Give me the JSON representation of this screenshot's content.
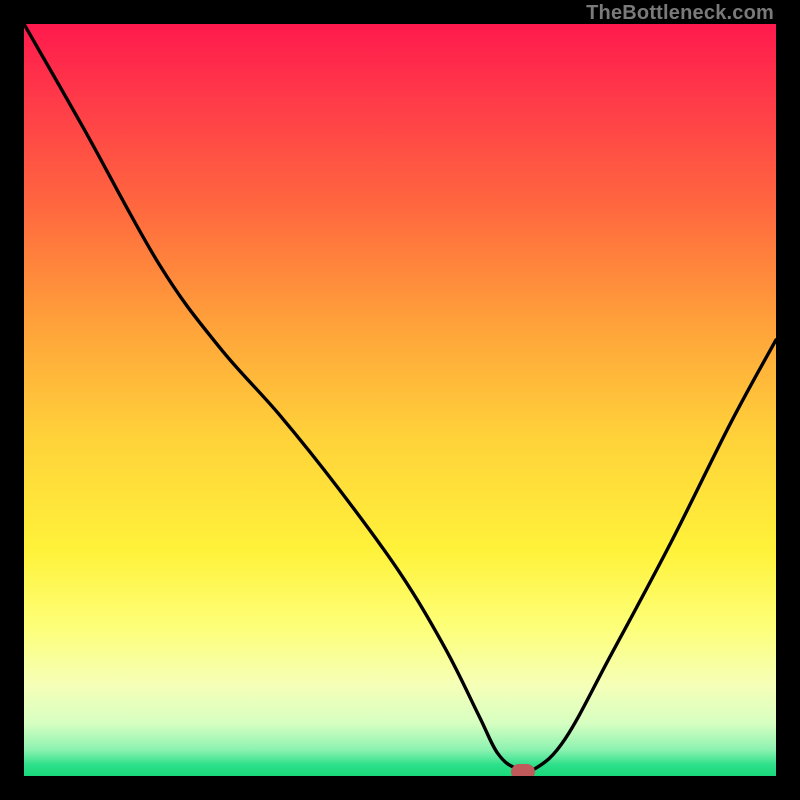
{
  "watermark": "TheBottleneck.com",
  "chart_data": {
    "type": "line",
    "title": "",
    "xlabel": "",
    "ylabel": "",
    "xlim": [
      0,
      100
    ],
    "ylim": [
      0,
      100
    ],
    "gradient_stops": [
      {
        "offset": 0.0,
        "color": "#ff1a4d"
      },
      {
        "offset": 0.1,
        "color": "#ff3a49"
      },
      {
        "offset": 0.25,
        "color": "#ff6a3e"
      },
      {
        "offset": 0.4,
        "color": "#ffa23a"
      },
      {
        "offset": 0.55,
        "color": "#ffd23a"
      },
      {
        "offset": 0.7,
        "color": "#fff23a"
      },
      {
        "offset": 0.8,
        "color": "#fdff77"
      },
      {
        "offset": 0.88,
        "color": "#f5ffb8"
      },
      {
        "offset": 0.93,
        "color": "#d7ffc2"
      },
      {
        "offset": 0.965,
        "color": "#8cf2b0"
      },
      {
        "offset": 0.985,
        "color": "#2ee08a"
      },
      {
        "offset": 1.0,
        "color": "#18d87a"
      }
    ],
    "series": [
      {
        "name": "bottleneck-curve",
        "x": [
          0.0,
          8.0,
          18.0,
          26.0,
          34.0,
          42.0,
          50.0,
          56.0,
          60.5,
          63.0,
          65.5,
          68.0,
          72.0,
          78.0,
          86.0,
          94.0,
          100.0
        ],
        "y": [
          100.0,
          86.0,
          68.0,
          57.0,
          48.0,
          38.0,
          27.0,
          17.0,
          8.0,
          3.0,
          1.0,
          1.0,
          5.0,
          16.0,
          31.0,
          47.0,
          58.0
        ]
      }
    ],
    "marker": {
      "name": "current-position",
      "x": 66.3,
      "y": 0.5,
      "color": "#c05a5a"
    }
  }
}
